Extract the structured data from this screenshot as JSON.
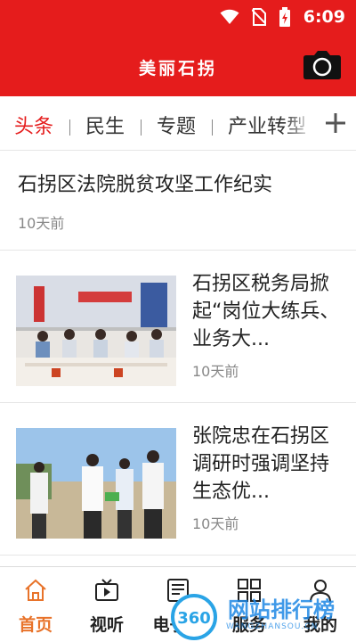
{
  "status_bar": {
    "time": "6:09",
    "icons": [
      "wifi-icon",
      "no-sim-icon",
      "battery-charging-icon"
    ]
  },
  "header": {
    "title": "美丽石拐",
    "camera_icon": "camera-icon"
  },
  "tabs": {
    "items": [
      "头条",
      "民生",
      "专题",
      "产业转型"
    ],
    "active": "头条",
    "add_icon": "plus-icon"
  },
  "feed": [
    {
      "title": "石拐区法院脱贫攻坚工作纪实",
      "time": "10天前",
      "has_image": false
    },
    {
      "title": "石拐区税务局掀起“岗位大练兵、业务大...",
      "time": "10天前",
      "has_image": true
    },
    {
      "title": "张院忠在石拐区调研时强调坚持生态优...",
      "time": "10天前",
      "has_image": true
    }
  ],
  "bottom_nav": [
    {
      "label": "首页",
      "icon": "home-icon",
      "active": true
    },
    {
      "label": "视听",
      "icon": "tv-play-icon",
      "active": false
    },
    {
      "label": "电子报",
      "icon": "newspaper-icon",
      "active": false
    },
    {
      "label": "服务",
      "icon": "grid-icon",
      "active": false
    },
    {
      "label": "我的",
      "icon": "user-icon",
      "active": false
    }
  ],
  "watermark": {
    "badge": "360",
    "text": "网站排行榜",
    "sub": "WANGZHANSOU.CN"
  },
  "colors": {
    "brand_red": "#e51c1c",
    "active_nav": "#e8732a",
    "muted_text": "#888888"
  }
}
